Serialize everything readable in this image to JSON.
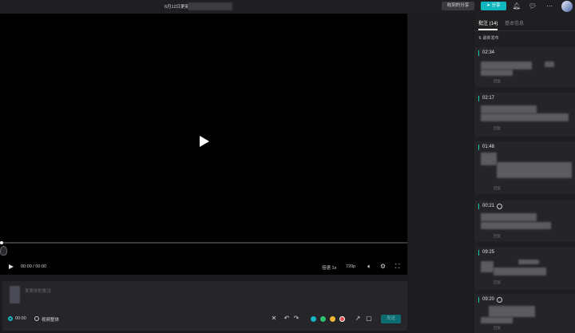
{
  "header": {
    "title": "6月12日更新",
    "received_share_label": "收到的分享",
    "share_label": "分享",
    "share_icon": "send-icon",
    "bell_icon": "bell-icon",
    "chat_icon": "chat-icon",
    "more_icon": "more-icon"
  },
  "player": {
    "time": "00:00 / 00:00",
    "speed": "倍速 1x",
    "resolution": "720p"
  },
  "composer": {
    "placeholder": "发表你的批注",
    "option_timestamp": "00:00",
    "option_whole": "视频整体",
    "send_label": "发送",
    "colors": [
      "#16b5c3",
      "#2ac26f",
      "#f2b531",
      "#e24a4a"
    ]
  },
  "sidebar": {
    "tab_comments": "批注 (14)",
    "tab_info": "基本信息",
    "sort_label": "最新发布",
    "comments": [
      {
        "time": "02:34",
        "reply": "回复"
      },
      {
        "time": "02:17",
        "reply": "回复"
      },
      {
        "time": "01:48",
        "reply": "回复"
      },
      {
        "time": "00:21",
        "reply": "回复"
      },
      {
        "time": "09:25",
        "reply": "回复"
      },
      {
        "time": "09:20",
        "reply": "回复"
      }
    ]
  }
}
